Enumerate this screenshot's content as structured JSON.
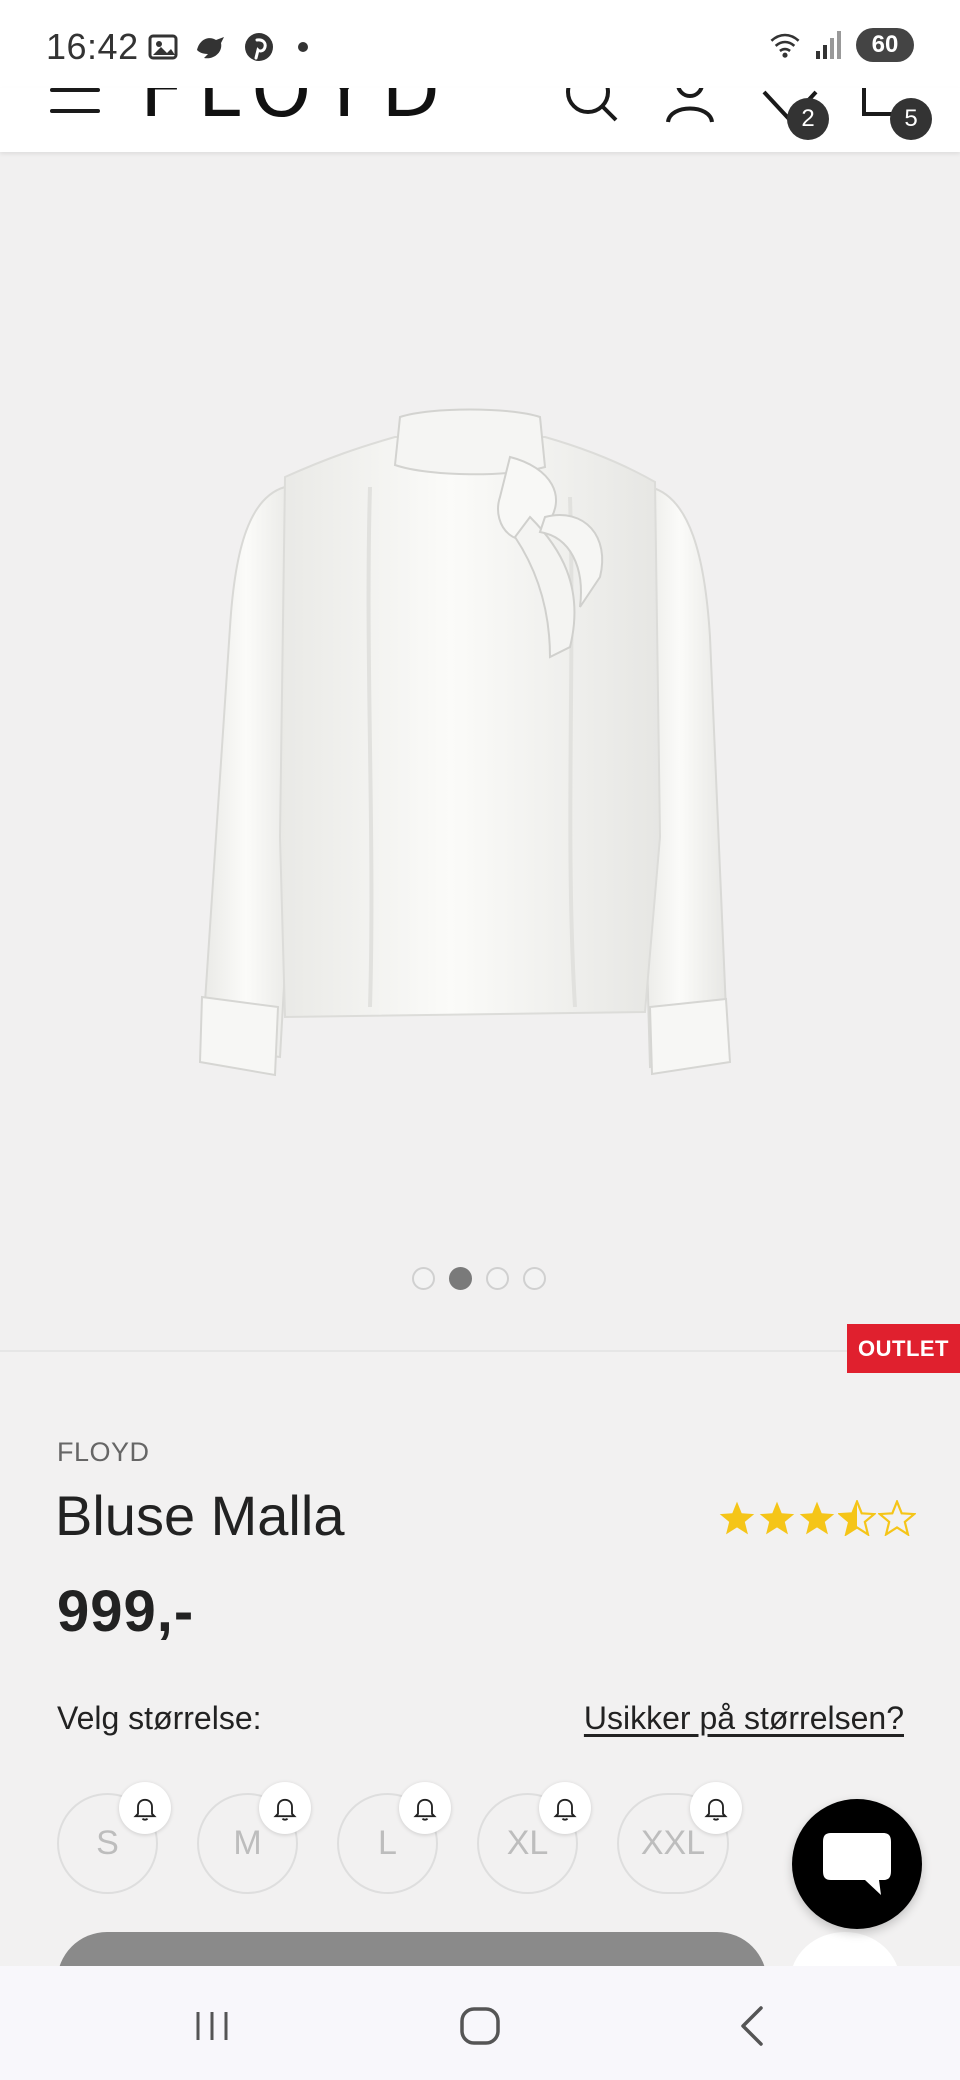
{
  "status_bar": {
    "time": "16:42",
    "battery": "60",
    "icons": [
      "gallery-icon",
      "bird-icon",
      "pinterest-icon",
      "dot-icon",
      "wifi-icon",
      "signal-icon",
      "battery-icon"
    ]
  },
  "header": {
    "logo": "FLOYD",
    "icons": [
      "menu-icon",
      "search-icon",
      "account-icon",
      "wishlist-icon",
      "cart-icon"
    ],
    "wishlist_count": "2",
    "cart_count": "5"
  },
  "gallery": {
    "image_count": 4,
    "active_index": 1
  },
  "product": {
    "badge": "OUTLET",
    "brand": "FLOYD",
    "title": "Bluse Malla",
    "rating": 3.5,
    "rating_max": 5,
    "price": "999,-"
  },
  "sizes": {
    "label": "Velg størrelse:",
    "help_link": "Usikker på størrelsen?",
    "options": [
      "S",
      "M",
      "L",
      "XL",
      "XXL"
    ]
  },
  "colors": {
    "accent_red": "#e0202e",
    "star_gold": "#f5c518",
    "badge_dark": "#333333"
  },
  "nav": {
    "icons": [
      "recent-apps-icon",
      "home-icon",
      "back-icon"
    ]
  }
}
